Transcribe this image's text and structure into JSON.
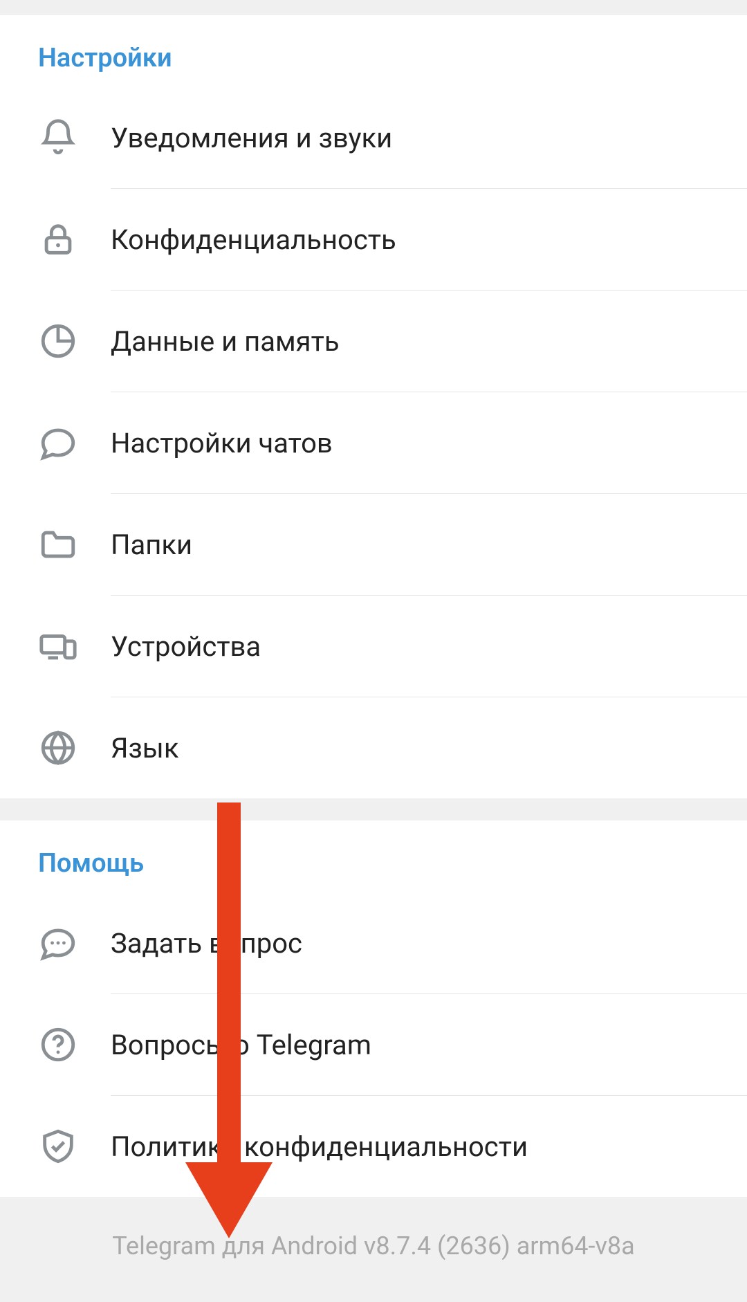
{
  "sections": {
    "settings": {
      "title": "Настройки",
      "items": [
        {
          "label": "Уведомления и звуки",
          "icon": "bell"
        },
        {
          "label": "Конфиденциальность",
          "icon": "lock"
        },
        {
          "label": "Данные и память",
          "icon": "pie"
        },
        {
          "label": "Настройки чатов",
          "icon": "chat"
        },
        {
          "label": "Папки",
          "icon": "folder"
        },
        {
          "label": "Устройства",
          "icon": "devices"
        },
        {
          "label": "Язык",
          "icon": "globe"
        }
      ]
    },
    "help": {
      "title": "Помощь",
      "items": [
        {
          "label": "Задать вопрос",
          "icon": "chat-dots"
        },
        {
          "label": "Вопросы о Telegram",
          "icon": "question"
        },
        {
          "label": "Политика конфиденциальности",
          "icon": "shield-check"
        }
      ]
    }
  },
  "footer": {
    "version_text": "Telegram для Android v8.7.4 (2636) arm64-v8a"
  },
  "annotation": {
    "arrow_color": "#e73e1c"
  }
}
